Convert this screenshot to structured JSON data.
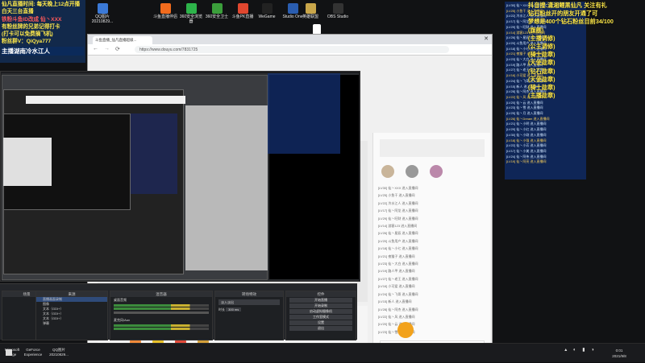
{
  "desktop": {
    "icons": [
      {
        "label": "QQ图片\n20210829...",
        "color": "#3b79d6"
      },
      {
        "label": "斗鱼直播伴侣",
        "color": "#f26b1d"
      },
      {
        "label": "360安全浏览器",
        "color": "#2db34a"
      },
      {
        "label": "360安全卫士",
        "color": "#3b9e3b"
      },
      {
        "label": "斗鱼PK直播",
        "color": "#e0472f"
      },
      {
        "label": "WeGame",
        "color": "#222"
      },
      {
        "label": "Studio One",
        "color": "#2a5db0"
      },
      {
        "label": "英雄联盟",
        "color": "#c9a64a"
      },
      {
        "label": "OBS Studio",
        "color": "#333"
      }
    ],
    "file_icon": "新建文本文档"
  },
  "overlay_left": {
    "lines": [
      {
        "text": "仙凡直播时间: 每天晚上12点开播",
        "color": "#ffe94a"
      },
      {
        "text": "白天三台直播",
        "color": "#ffe94a"
      },
      {
        "text": "铁粉斗鱼ID改成 仙丶XXX",
        "color": "#ff5a5a"
      },
      {
        "text": "有粉丝牌的兄弟记得打卡",
        "color": "#ffe94a"
      },
      {
        "text": "(打卡可以免费摘飞机)",
        "color": "#ffe94a"
      },
      {
        "text": "粉丝群V：QiQya777",
        "color": "#ffe94a"
      }
    ],
    "streamer": "主播湖南冷水江人"
  },
  "browser": {
    "tab_title": "斗鱼直播_仙凡直播超级...",
    "url": "https://www.douyu.com/7831725",
    "close_glyph": "✕",
    "nav": [
      "←",
      "→",
      "⟳"
    ]
  },
  "obs": {
    "docks": [
      {
        "title": "场景"
      },
      {
        "title": "来源"
      },
      {
        "title": "混音器"
      },
      {
        "title": "转场特效"
      },
      {
        "title": "控件"
      }
    ],
    "sources": [
      "直播画面录制",
      "图像",
      "文本（GDI+）",
      "文本（GDI+）",
      "文本（GDI+）",
      "弹幕"
    ],
    "mixer": [
      {
        "name": "桌面音频",
        "value": "0.0 dB"
      },
      {
        "name": "麦克风/Aux",
        "value": "0.0 dB"
      }
    ],
    "transition": {
      "type": "淡入淡出",
      "duration_label": "时长",
      "duration": "300 ms"
    },
    "controls": [
      "开始直播",
      "开始录制",
      "启动虚拟摄像机",
      "工作室模式",
      "设置",
      "退出"
    ]
  },
  "overlay_right": {
    "big_lines": [
      "抖音搜:潇湘鲤黑仙凡  关注有礼",
      "钻石粉丝开的朋友开通了可",
      "梦想是400个钻石粉丝目前34/100",
      "(旗舰)",
      "(主播调修)",
      "(公主调修)",
      "(骑士勋章)",
      "(天使勋章)",
      "(钻石勋章)",
      "(天使勋章)",
      "(骑士勋章)",
      "(主播勋章)"
    ],
    "chat": [
      "[LV30] 仙丶XXX 进入直播间",
      "[LV25] 小鱼干 进入直播间",
      "[LV22] 冷水江人 进入直播间",
      "[LV17] 仙丶阿龙 进入直播间",
      "[LV29] 仙丶旺财 进入直播间",
      "[LV14] 游客123 进入直播间",
      "[LV26] 仙丶星辰 进入直播间",
      "[LV20] 斗鱼用户 进入直播间",
      "[LV18] 仙丶小七 进入直播间",
      "[LV21] 夜猫子 进入直播间",
      "[LV23] 仙丶大白 进入直播间",
      "[LV19] 路人甲 进入直播间",
      "[LV27] 仙丶老王 进入直播间",
      "[LV16] 小可爱 进入直播间",
      "[LV24] 仙丶飞哥 进入直播间",
      "[LV15] 新人 进入直播间",
      "[LV28] 仙丶阿杰 进入直播间",
      "[LV22] 仙丶风 进入直播间",
      "[LV20] 仙丶云 进入直播间",
      "[LV23] 仙丶雪 进入直播间",
      "[LV25] 仙丶月 进入直播间",
      "[LV26] 仙丶Dream 进入直播间",
      "[LV21] 仙丶小明 进入直播间",
      "[LV29] 仙丶小红 进入直播间",
      "[LV30] 仙丶小刚 进入直播间",
      "[LV18] 仙丶小强 进入直播间",
      "[LV22] 仙丶小芳 进入直播间",
      "[LV17] 仙丶小美 进入直播间",
      "[LV24] 仙丶阿伟 进入直播间",
      "[LV19] 仙丶阿亮 进入直播间"
    ]
  },
  "taskbar": {
    "items": [
      "Microsoft Edge",
      "GeForce Experience",
      "QQ图片 20210829..."
    ],
    "time": "0:01",
    "date": "2021/9/8"
  }
}
